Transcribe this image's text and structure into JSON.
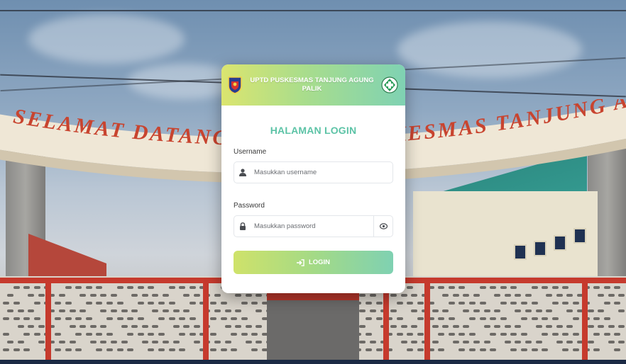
{
  "header": {
    "title": "UPTD PUSKESMAS TANJUNG AGUNG PALIK",
    "left_logo_icon": "regional-crest-icon",
    "right_logo_icon": "puskesmas-cross-icon"
  },
  "login": {
    "heading": "HALAMAN LOGIN",
    "username_label": "Username",
    "username_placeholder": "Masukkan username",
    "username_icon": "user-icon",
    "password_label": "Password",
    "password_placeholder": "Masukkan password",
    "password_icon": "lock-icon",
    "toggle_icon": "eye-icon",
    "button_label": "LOGIN",
    "button_icon": "sign-in-icon"
  },
  "background": {
    "arch_text": "SELAMAT DATANG DI UPTD PUSKESMAS TANJUNG AGUNG PALIK"
  },
  "colors": {
    "accent": "#5cc3a6",
    "gradient_start": "#dbe56f",
    "gradient_end": "#7fd2b3",
    "arch_text": "#c8442f"
  }
}
